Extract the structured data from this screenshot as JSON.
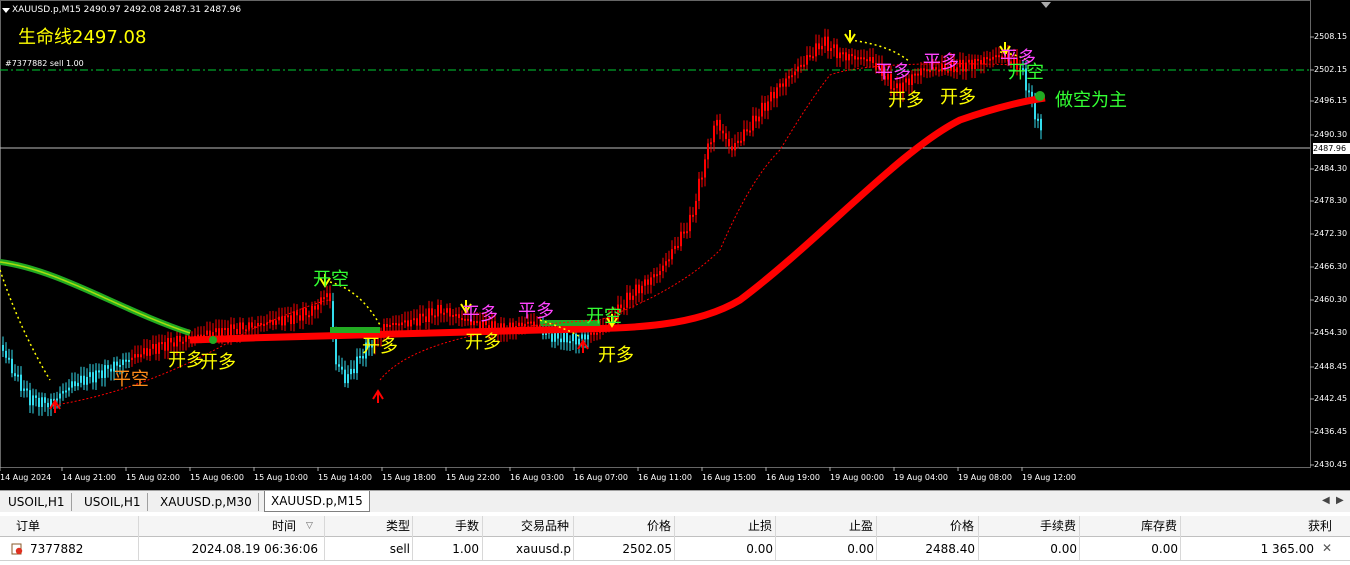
{
  "chart": {
    "header": "XAUUSD.p,M15  2490.97 2492.08 2487.31 2487.96",
    "lifeline": "生命线2497.08",
    "order_tag": "#7377882 sell 1.00",
    "current_price": "2487.96",
    "price_labels": [
      "2508.15",
      "2502.15",
      "2496.15",
      "2490.30",
      "2484.30",
      "2478.30",
      "2472.30",
      "2466.30",
      "2460.30",
      "2454.30",
      "2448.45",
      "2442.45",
      "2436.45",
      "2430.45"
    ],
    "time_labels": [
      "14 Aug 2024",
      "14 Aug 21:00",
      "15 Aug 02:00",
      "15 Aug 06:00",
      "15 Aug 10:00",
      "15 Aug 14:00",
      "15 Aug 18:00",
      "15 Aug 22:00",
      "16 Aug 03:00",
      "16 Aug 07:00",
      "16 Aug 11:00",
      "16 Aug 15:00",
      "16 Aug 19:00",
      "19 Aug 00:00",
      "19 Aug 04:00",
      "19 Aug 08:00",
      "19 Aug 12:00"
    ],
    "annotations": [
      {
        "text": "平空",
        "color": "#ff8c1a"
      },
      {
        "text": "开多",
        "color": "#ffff00"
      },
      {
        "text": "开多",
        "color": "#ffff00"
      },
      {
        "text": "开空",
        "color": "#33ff33"
      },
      {
        "text": "开多",
        "color": "#ffff00"
      },
      {
        "text": "平多",
        "color": "#ff44ff"
      },
      {
        "text": "开多",
        "color": "#ffff00"
      },
      {
        "text": "平多",
        "color": "#ff44ff"
      },
      {
        "text": "开空",
        "color": "#33ff33"
      },
      {
        "text": "开多",
        "color": "#ffff00"
      },
      {
        "text": "平多",
        "color": "#ff44ff"
      },
      {
        "text": "平多",
        "color": "#ff44ff"
      },
      {
        "text": "开多",
        "color": "#ffff00"
      },
      {
        "text": "开多",
        "color": "#ffff00"
      },
      {
        "text": "平多",
        "color": "#ff44ff"
      },
      {
        "text": "开空",
        "color": "#33ff33"
      },
      {
        "text": "做空为主",
        "color": "#33ff33"
      }
    ],
    "colors": {
      "background": "#000000",
      "bull": "#ff0000",
      "bear": "#33ddee",
      "signal": "#ffff00",
      "trend_up": "#ff0000",
      "trend_flat": "#22aa22",
      "order_line": "#00cc33"
    }
  },
  "tabs": {
    "items": [
      {
        "label": "USOIL,H1"
      },
      {
        "label": "USOIL,H1"
      },
      {
        "label": "XAUUSD.p,M30"
      },
      {
        "label": "XAUUSD.p,M15"
      }
    ],
    "active": "XAUUSD.p,M15",
    "prev_icon": "triangle-left-icon",
    "next_icon": "triangle-right-icon"
  },
  "trade_table": {
    "headers": {
      "order": "订单",
      "time": "时间",
      "type": "类型",
      "volume": "手数",
      "symbol": "交易品种",
      "price": "价格",
      "sl": "止损",
      "tp": "止盈",
      "cur_price": "价格",
      "commission": "手续费",
      "swap": "库存费",
      "profit": "获利"
    },
    "sort_icon": "▽",
    "rows": [
      {
        "order": "7377882",
        "time": "2024.08.19 06:36:06",
        "type": "sell",
        "volume": "1.00",
        "symbol": "xauusd.p",
        "price": "2502.05",
        "sl": "0.00",
        "tp": "0.00",
        "cur_price": "2488.40",
        "commission": "0.00",
        "swap": "0.00",
        "profit": "1 365.00"
      }
    ]
  }
}
